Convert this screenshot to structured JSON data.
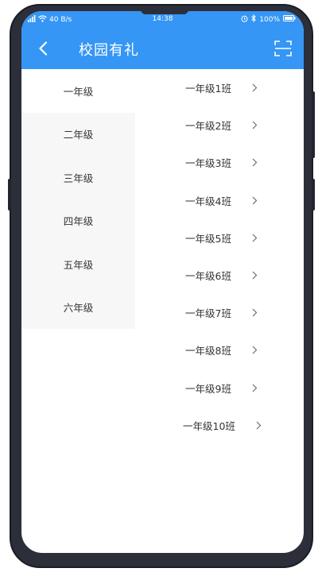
{
  "status_bar": {
    "network_speed": "40 B/s",
    "time": "14:38",
    "battery": "100%"
  },
  "header": {
    "title": "校园有礼",
    "back_icon": "chevron-left-icon",
    "scan_icon": "scan-icon"
  },
  "grades": [
    {
      "label": "一年级",
      "active": true
    },
    {
      "label": "二年级",
      "active": false
    },
    {
      "label": "三年级",
      "active": false
    },
    {
      "label": "四年级",
      "active": false
    },
    {
      "label": "五年级",
      "active": false
    },
    {
      "label": "六年级",
      "active": false
    }
  ],
  "classes": [
    {
      "label": "一年级1班"
    },
    {
      "label": "一年级2班"
    },
    {
      "label": "一年级3班"
    },
    {
      "label": "一年级4班"
    },
    {
      "label": "一年级5班"
    },
    {
      "label": "一年级6班"
    },
    {
      "label": "一年级7班"
    },
    {
      "label": "一年级8班"
    },
    {
      "label": "一年级9班"
    },
    {
      "label": "一年级10班"
    }
  ],
  "colors": {
    "accent": "#3596f5",
    "sidebar_bg": "#f7f7f7",
    "text": "#333333",
    "frame": "#2c2f3a"
  }
}
